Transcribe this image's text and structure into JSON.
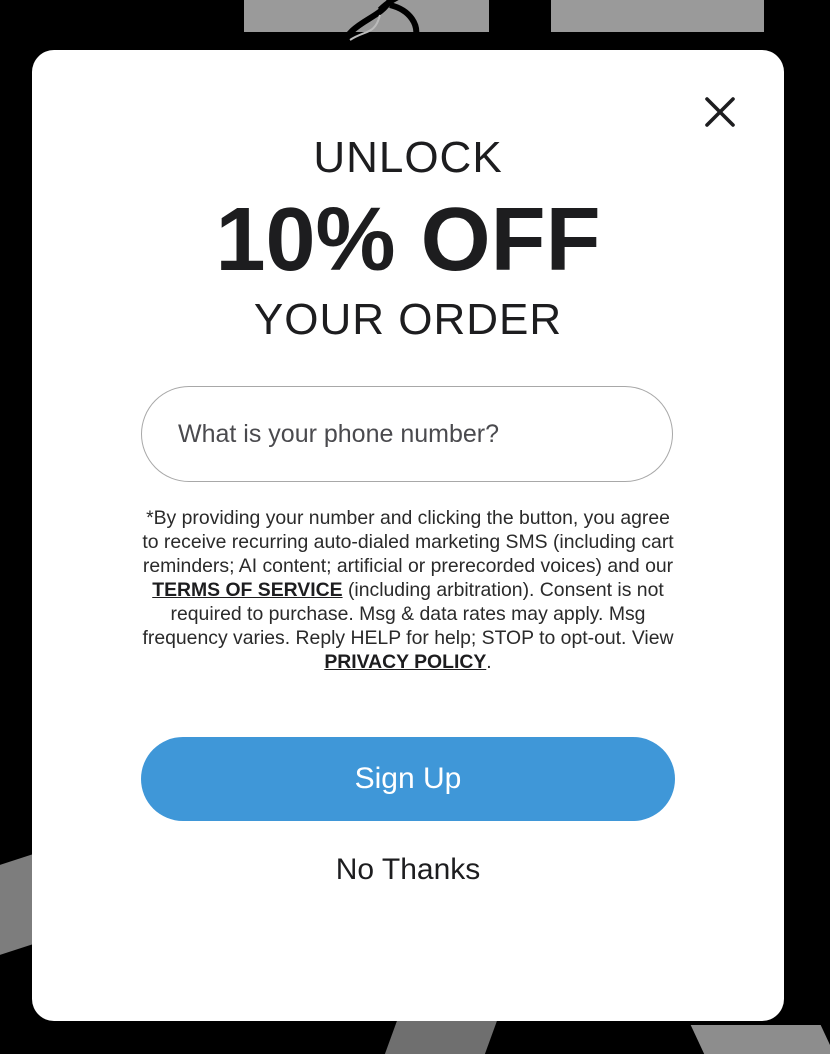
{
  "colors": {
    "accent": "#3f97d8",
    "text": "#1d1d1f",
    "modal_background": "#ffffff",
    "page_background": "#000000"
  },
  "modal": {
    "close_icon": "close-icon",
    "headline_top": "UNLOCK",
    "headline_main": "10% OFF",
    "headline_bottom": "YOUR ORDER",
    "phone_placeholder": "What is your phone number?",
    "phone_value": "",
    "disclaimer": {
      "part1": "*By providing your number and clicking the button, you agree to receive recurring auto-dialed marketing SMS (including cart reminders; AI content; artificial or prerecorded voices) and our ",
      "terms_link": "TERMS OF SERVICE",
      "part2": " (including arbitration). Consent is not required to purchase. Msg & data rates may apply. Msg frequency varies. Reply HELP for help; STOP to opt-out. View ",
      "privacy_link": "PRIVACY POLICY",
      "part3": "."
    },
    "signup_label": "Sign Up",
    "no_thanks_label": "No Thanks"
  }
}
